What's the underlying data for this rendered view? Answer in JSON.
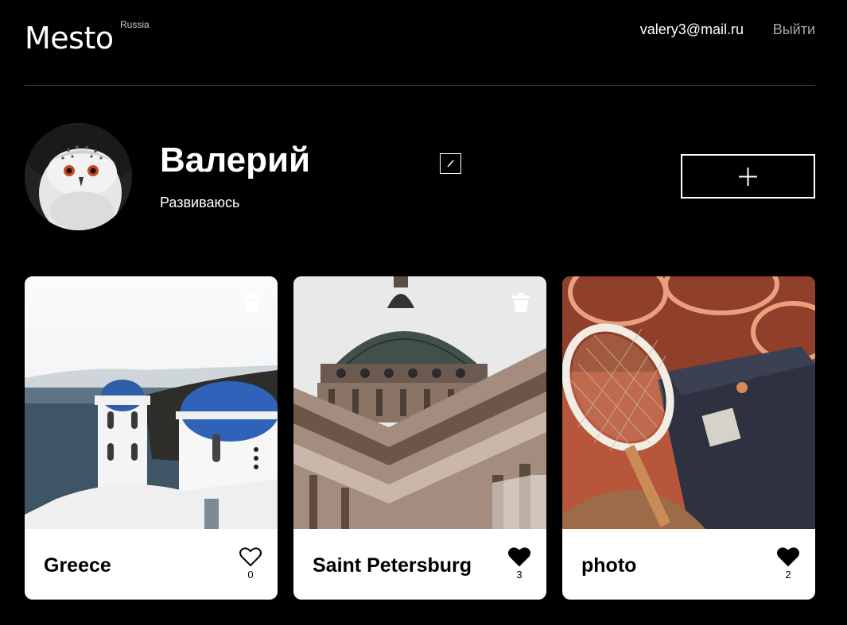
{
  "header": {
    "logo_text": "Mesto",
    "logo_sup": "Russia",
    "email": "valery3@mail.ru",
    "logout_label": "Выйти"
  },
  "profile": {
    "name": "Валерий",
    "about": "Развиваюсь"
  },
  "cards": [
    {
      "title": "Greece",
      "likes": "0",
      "liked": false,
      "trash": true,
      "image": "greece-photo"
    },
    {
      "title": "Saint Petersburg",
      "likes": "3",
      "liked": true,
      "trash": true,
      "image": "saint-petersburg-photo"
    },
    {
      "title": "photo",
      "likes": "2",
      "liked": true,
      "trash": false,
      "image": "tennis-rackets-photo"
    }
  ],
  "icons": {
    "edit": "pencil-icon",
    "add": "plus-icon",
    "like": "heart-icon",
    "delete": "trash-icon"
  },
  "colors": {
    "background": "#000000",
    "card": "#ffffff",
    "logout": "#a9a9a9"
  }
}
